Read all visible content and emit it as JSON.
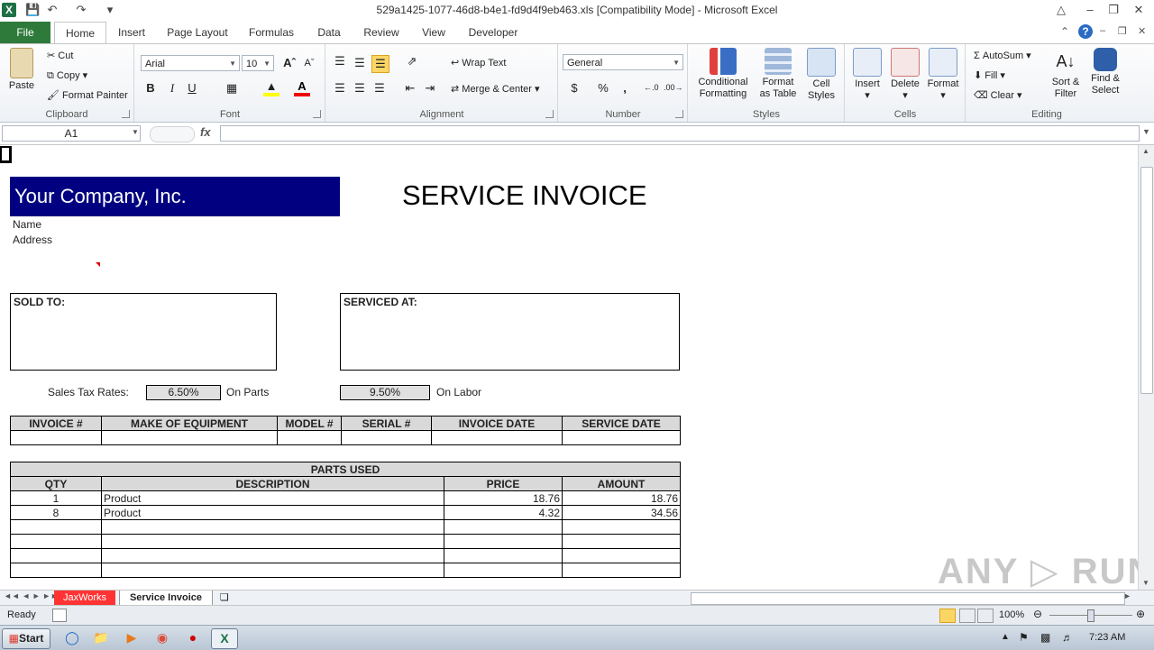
{
  "window": {
    "title": "529a1425-1077-46d8-b4e1-fd9d4f9eb463.xls  [Compatibility Mode]  -  Microsoft Excel"
  },
  "tabs": [
    "File",
    "Home",
    "Insert",
    "Page Layout",
    "Formulas",
    "Data",
    "Review",
    "View",
    "Developer"
  ],
  "ribbon": {
    "clipboard": {
      "paste": "Paste",
      "cut": "Cut",
      "copy": "Copy",
      "format_painter": "Format Painter",
      "label": "Clipboard"
    },
    "font": {
      "name": "Arial",
      "size": "10",
      "bold": "B",
      "italic": "I",
      "underline": "U",
      "label": "Font"
    },
    "alignment": {
      "wrap": "Wrap Text",
      "merge": "Merge & Center",
      "label": "Alignment"
    },
    "number": {
      "format": "General",
      "currency": "$",
      "percent": "%",
      "comma": ",",
      "inc": ".0 .00",
      "dec": ".00 .0",
      "label": "Number"
    },
    "styles": {
      "conditional": "Conditional",
      "conditional2": "Formatting",
      "format_table": "Format",
      "format_table2": "as Table",
      "cell_styles": "Cell",
      "cell_styles2": "Styles",
      "label": "Styles"
    },
    "cells": {
      "insert": "Insert",
      "delete": "Delete",
      "format": "Format",
      "label": "Cells"
    },
    "editing": {
      "autosum": "AutoSum",
      "fill": "Fill",
      "clear": "Clear",
      "sort": "Sort &",
      "sort2": "Filter",
      "find": "Find &",
      "find2": "Select",
      "label": "Editing"
    }
  },
  "formula_bar": {
    "name_box": "A1",
    "fx": "fx",
    "value": ""
  },
  "invoice": {
    "company": "Your Company, Inc.",
    "title": "SERVICE INVOICE",
    "name": "Name",
    "address": "Address",
    "sold_to": "SOLD TO:",
    "serviced_at": "SERVICED AT:",
    "tax_label": "Sales Tax Rates:",
    "tax_parts": "6.50%",
    "on_parts": "On Parts",
    "tax_labor": "9.50%",
    "on_labor": "On Labor",
    "info_headers": [
      "INVOICE #",
      "MAKE OF EQUIPMENT",
      "MODEL #",
      "SERIAL #",
      "INVOICE DATE",
      "SERVICE DATE"
    ],
    "parts_title": "PARTS USED",
    "parts_headers": [
      "QTY",
      "DESCRIPTION",
      "PRICE",
      "AMOUNT"
    ],
    "parts_rows": [
      {
        "qty": "1",
        "desc": "Product",
        "price": "18.76",
        "amount": "18.76"
      },
      {
        "qty": "8",
        "desc": "Product",
        "price": "4.32",
        "amount": "34.56"
      }
    ]
  },
  "sheets": [
    "JaxWorks",
    "Service Invoice"
  ],
  "status": {
    "ready": "Ready",
    "zoom": "100%"
  },
  "taskbar": {
    "start": "Start",
    "time": "7:23 AM"
  },
  "colors": {
    "company_bg": "#000080",
    "tab_red": "#ff3333",
    "file_tab": "#2d7a3a"
  }
}
